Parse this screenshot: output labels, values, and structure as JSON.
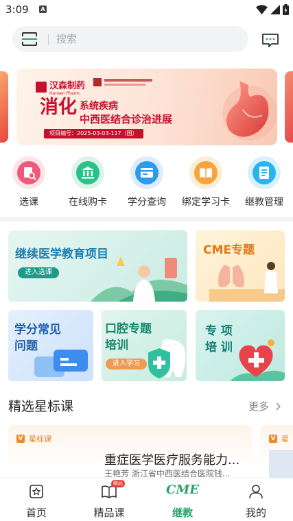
{
  "status_bar": {
    "time": "3:09",
    "notice_glyph": "A",
    "icons": [
      "wifi-icon",
      "signal-icon",
      "battery-icon"
    ]
  },
  "search": {
    "placeholder": "搜索"
  },
  "banner": {
    "logo_text": "汉森制药",
    "logo_sub": "Hansen Pharm.",
    "title_big": "消化",
    "title_part": "系统疾病",
    "title_line2": "中西医结合诊治进展",
    "code": "项目编号：2025-03-03-117（国）"
  },
  "quick_nav": [
    {
      "label": "选课",
      "icon": "course-select-icon",
      "color": "#f05a7a"
    },
    {
      "label": "在线购卡",
      "icon": "bank-icon",
      "color": "#2cc08a"
    },
    {
      "label": "学分查询",
      "icon": "credit-card-icon",
      "color": "#2a9cf0"
    },
    {
      "label": "绑定学习卡",
      "icon": "learning-card-icon",
      "color": "#f7a53a"
    },
    {
      "label": "继教管理",
      "icon": "document-icon",
      "color": "#28b4f0"
    }
  ],
  "cards": {
    "continuing_edu": {
      "title": "继续医学教育项目",
      "button": "进入选课"
    },
    "cme_topic": {
      "title": "CME专题"
    },
    "credit_faq": {
      "title_1": "学分常见",
      "title_2": "问题"
    },
    "oral_training": {
      "title_1": "口腔专题",
      "title_2": "培训",
      "button": "进入学习"
    },
    "special_training": {
      "title_1": "专 项",
      "title_2": "培 训"
    }
  },
  "section": {
    "title": "精选星标课",
    "more": "更多"
  },
  "course": {
    "tag": "星标课",
    "tag_glyph": "V",
    "title": "重症医学医疗服务能力...",
    "subtitle": "王艳芳  浙江省中西医结合医院钱...",
    "peek_tag": "星"
  },
  "tab_bar": {
    "tabs": [
      {
        "label": "首页",
        "icon": "home-star-icon"
      },
      {
        "label": "精品课",
        "icon": "book-icon",
        "badge": "精品"
      },
      {
        "label": "继教",
        "icon": "cme-logo-icon",
        "logo": "CME",
        "active": true
      },
      {
        "label": "我的",
        "icon": "user-icon"
      }
    ]
  },
  "colors": {
    "accent_green": "#2aa36a",
    "brand_red": "#c8102e",
    "star_orange": "#e8821c"
  }
}
